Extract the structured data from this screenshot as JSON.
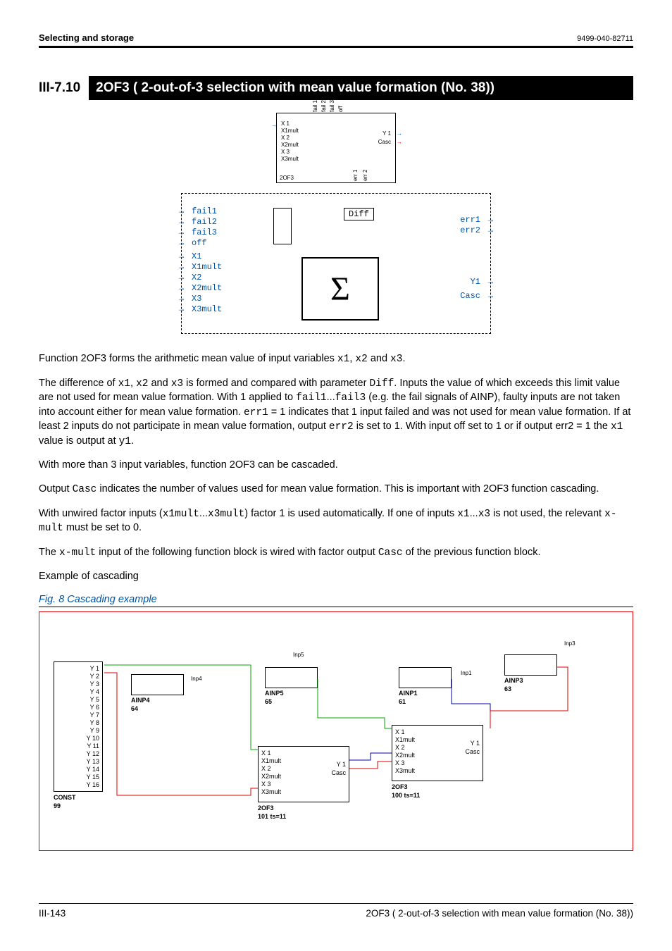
{
  "header": {
    "left": "Selecting and storage",
    "right": "9499-040-82711"
  },
  "section": {
    "number": "III-7.10",
    "title": "2OF3 ( 2-out-of-3 selection with mean value formation (No. 38))"
  },
  "diagram_small": {
    "inputs": [
      "X 1",
      "X1mult",
      "X 2",
      "X2mult",
      "X 3",
      "X3mult"
    ],
    "top": [
      "fail 1",
      "fail 2",
      "fail 3",
      "off"
    ],
    "outputs_right": [
      "Y 1",
      "Casc"
    ],
    "outputs_bottom": [
      "err 1",
      "err 2"
    ],
    "name": "2OF3"
  },
  "diagram_large": {
    "left": [
      "fail1",
      "fail2",
      "fail3",
      "off",
      "X1",
      "X1mult",
      "X2",
      "X2mult",
      "X3",
      "X3mult"
    ],
    "diff": "Diff",
    "sigma": "Σ",
    "right_top": [
      "err1",
      "err2"
    ],
    "right_bottom": [
      "Y1",
      "Casc"
    ]
  },
  "body": {
    "p1a": "Function 2OF3 forms the arithmetic mean value of input variables ",
    "p1_x1": "x1",
    "p1_c1": ", ",
    "p1_x2": "x2",
    "p1_c2": " and ",
    "p1_x3": "x3",
    "p1_end": ".",
    "p2a": "The difference of ",
    "p2_c1": ", ",
    "p2_c2": " and ",
    "p2b": " is formed and compared with parameter ",
    "p2_diff": "Diff",
    "p2c": ". Inputs the value of which exceeds this limit value are not used for mean value formation. With 1 applied to ",
    "p2_fail1": "fail1",
    "p2_d": "...",
    "p2_fail3": "fail3",
    "p2e": " (e.g. the fail signals of AINP), faulty inputs are not taken into account either for mean value formation. ",
    "p2_err1": "err1",
    "p2f": " = 1 indicates that 1 input failed and was not used for mean value formation. If at least 2 inputs do not participate in mean value formation, output ",
    "p2_err2": "err2",
    "p2g": " is set to 1. With input off set to 1 or if output err2 = 1 the ",
    "p2h": " value is output at ",
    "p2_y1": "y1",
    "p2i": ".",
    "p3": "With more than 3 input variables, function 2OF3 can be cascaded.",
    "p4a": "Output ",
    "p4_casc": "Casc",
    "p4b": " indicates the number of values used for mean value formation. This is important with 2OF3 function cascading.",
    "p5a": "With unwired factor inputs (",
    "p5_m1": "x1mult",
    "p5_d": "...",
    "p5_m3": "x3mult",
    "p5b": ") factor 1 is used automatically. If one of inputs ",
    "p5_x1": "x1",
    "p5_d2": "...",
    "p5_x3": "x3",
    "p5c": " is not used, the relevant ",
    "p5_xm": "x-mult",
    "p5d": "  must be set to 0.",
    "p6a": "The ",
    "p6_xm": "x-mult",
    "p6b": " input of the following function block is wired with factor output ",
    "p6_casc": "Casc",
    "p6c": " of the previous function block.",
    "p7": "Example of cascading"
  },
  "fig8": {
    "caption": "Fig. 8  Cascading example",
    "const": {
      "name": "CONST",
      "id": "99",
      "ys": [
        "Y 1",
        "Y 2",
        "Y 3",
        "Y 4",
        "Y 5",
        "Y 6",
        "Y 7",
        "Y 8",
        "Y 9",
        "Y 10",
        "Y 11",
        "Y 12",
        "Y 13",
        "Y 14",
        "Y 15",
        "Y 16"
      ]
    },
    "ainp4": {
      "name": "AINP4",
      "id": "64",
      "inp": "Inp4"
    },
    "ainp5": {
      "name": "AINP5",
      "id": "65",
      "inp": "Inp5"
    },
    "ainp1": {
      "name": "AINP1",
      "id": "61",
      "inp": "Inp1"
    },
    "ainp3": {
      "name": "AINP3",
      "id": "63",
      "inp": "Inp3"
    },
    "twoOf3_a": {
      "name": "2OF3",
      "id": "101 ts=11",
      "inputs": [
        "X 1",
        "X1mult",
        "X 2",
        "X2mult",
        "X 3",
        "X3mult"
      ],
      "out": [
        "Y 1",
        "Casc"
      ]
    },
    "twoOf3_b": {
      "name": "2OF3",
      "id": "100 ts=11",
      "inputs": [
        "X 1",
        "X1mult",
        "X 2",
        "X2mult",
        "X 3",
        "X3mult"
      ],
      "out": [
        "Y 1",
        "Casc"
      ]
    }
  },
  "footer": {
    "left": "III-143",
    "right": "2OF3 ( 2-out-of-3 selection with mean value formation (No. 38))"
  }
}
